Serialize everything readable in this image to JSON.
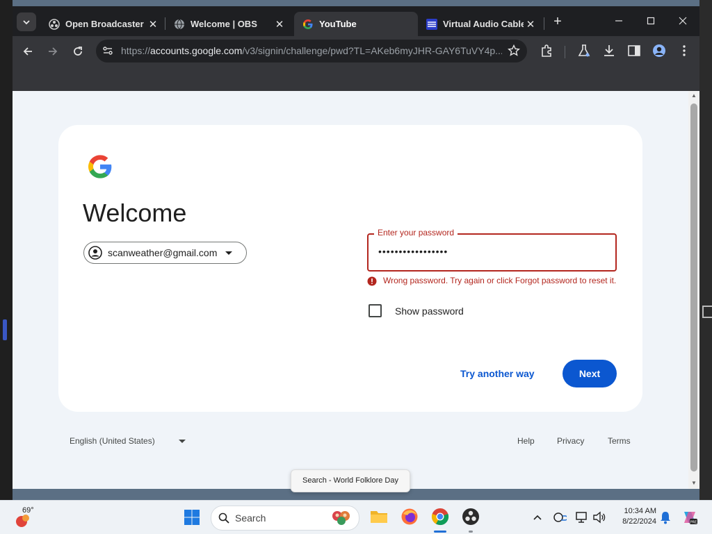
{
  "browser": {
    "tabs": [
      {
        "title": "Open Broadcaster Sc",
        "icon": "obs-icon",
        "active": false
      },
      {
        "title": "Welcome | OBS",
        "icon": "globe-icon",
        "active": false
      },
      {
        "title": "YouTube",
        "icon": "google-icon",
        "active": true
      },
      {
        "title": "Virtual Audio Cable",
        "icon": "vac-icon",
        "active": false
      }
    ],
    "url_prefix": "https://",
    "url_host": "accounts.google.com",
    "url_path": "/v3/signin/challenge/pwd?TL=AKeb6myJHR-GAY6TuVY4p..."
  },
  "signin": {
    "heading": "Welcome",
    "account_email": "scanweather@gmail.com",
    "password_label": "Enter your password",
    "password_value": "•••••••••••••••••",
    "error_text": "Wrong password. Try again or click Forgot password to reset it.",
    "show_password_label": "Show password",
    "try_another_way": "Try another way",
    "next_label": "Next",
    "show_password_checked": false
  },
  "footer": {
    "language": "English (United States)",
    "links": [
      "Help",
      "Privacy",
      "Terms"
    ]
  },
  "tooltip": "Search - World Folklore Day",
  "taskbar": {
    "temperature": "69°",
    "search_placeholder": "Search",
    "time": "10:34 AM",
    "date": "8/22/2024"
  },
  "colors": {
    "google_blue": "#0b57d0",
    "error_red": "#b3261e",
    "tab_bar": "#1e1f22",
    "toolbar": "#35363a"
  }
}
